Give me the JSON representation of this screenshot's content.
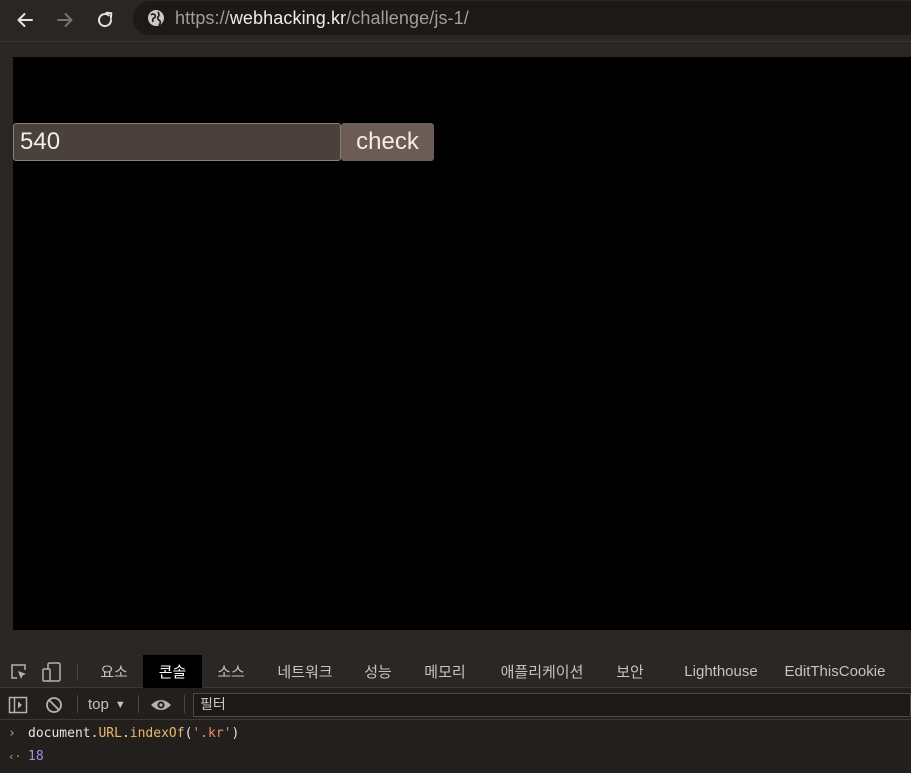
{
  "browser": {
    "back_icon": "arrow-left-icon",
    "forward_icon": "arrow-right-icon",
    "reload_icon": "reload-icon",
    "site_info_icon": "globe-icon",
    "url_scheme": "https://",
    "url_host": "webhacking.kr",
    "url_path": "/challenge/js-1/"
  },
  "page": {
    "input_value": "540",
    "check_label": "check"
  },
  "devtools": {
    "inspect_icon": "inspect-element-icon",
    "device_icon": "device-toolbar-icon",
    "tabs": [
      {
        "label": "요소"
      },
      {
        "label": "콘솔",
        "active": true
      },
      {
        "label": "소스"
      },
      {
        "label": "네트워크"
      },
      {
        "label": "성능"
      },
      {
        "label": "메모리"
      },
      {
        "label": "애플리케이션"
      },
      {
        "label": "보안"
      },
      {
        "label": "Lighthouse"
      },
      {
        "label": "EditThisCookie"
      }
    ],
    "toolbar": {
      "sidebar_icon": "show-sidebar-icon",
      "clear_icon": "clear-console-icon",
      "context": "top",
      "eye_icon": "live-expression-eye-icon",
      "filter_placeholder": "필터"
    },
    "console": {
      "input_prompt": "›",
      "input_obj": "document",
      "input_dot1": ".",
      "input_prop": "URL",
      "input_dot2": ".",
      "input_method": "indexOf",
      "input_open": "(",
      "input_arg": "'.kr'",
      "input_close": ")",
      "result_prompt": "‹·",
      "result_value": "18"
    }
  },
  "colors": {
    "accent_active_tab": "#000000",
    "check_button": "#6b5d55",
    "input_bg": "#4a413c"
  }
}
